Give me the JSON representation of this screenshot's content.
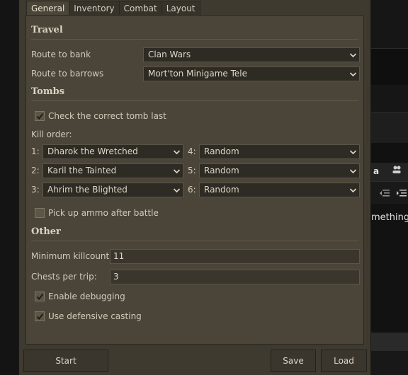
{
  "background": {
    "snippet_text": "mething",
    "icon_a": "a"
  },
  "tabs": [
    {
      "label": "General",
      "active": true
    },
    {
      "label": "Inventory",
      "active": false
    },
    {
      "label": "Combat",
      "active": false
    },
    {
      "label": "Layout",
      "active": false
    }
  ],
  "travel": {
    "title": "Travel",
    "bank_label": "Route to bank",
    "bank_value": "Clan Wars",
    "barrows_label": "Route to barrows",
    "barrows_value": "Mort'ton Minigame Tele"
  },
  "tombs": {
    "title": "Tombs",
    "check_last_label": "Check the correct tomb last",
    "check_last_checked": true,
    "kill_order_label": "Kill order:",
    "order": [
      {
        "num": "1:",
        "value": "Dharok the Wretched"
      },
      {
        "num": "2:",
        "value": "Karil the Tainted"
      },
      {
        "num": "3:",
        "value": "Ahrim the Blighted"
      },
      {
        "num": "4:",
        "value": "Random"
      },
      {
        "num": "5:",
        "value": "Random"
      },
      {
        "num": "6:",
        "value": "Random"
      }
    ],
    "ammo_label": "Pick up ammo after battle",
    "ammo_checked": false
  },
  "other": {
    "title": "Other",
    "killcount_label": "Minimum killcount:",
    "killcount_value": "11",
    "chests_label": "Chests per trip:",
    "chests_value": "3",
    "debug_label": "Enable debugging",
    "debug_checked": true,
    "defensive_label": "Use defensive casting",
    "defensive_checked": true
  },
  "buttons": {
    "start": "Start",
    "save": "Save",
    "load": "Load"
  },
  "colors": {
    "panel": "#4a4538",
    "window": "#3e3a30",
    "field": "#2e2b24"
  }
}
